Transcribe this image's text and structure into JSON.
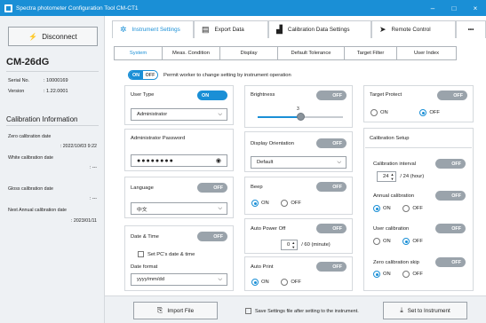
{
  "window": {
    "title": "Spectra photometer Configuration Tool CM-CT1",
    "minimize": "–",
    "maximize": "□",
    "close": "×"
  },
  "sidebar": {
    "disconnect_label": "Disconnect",
    "model": "CM-26dG",
    "serial_label": "Serial No.",
    "serial_value": ": 10000169",
    "version_label": "Version",
    "version_value": ": 1.22.0001",
    "cal_heading": "Calibration Information",
    "zero_label": "Zero calibration date",
    "zero_value": ": 2022/10/03 9:22",
    "white_label": "White calibration date",
    "white_value": ": ---",
    "gloss_label": "Gloss calibration date",
    "gloss_value": ": ---",
    "next_label": "Next Annual calibration date",
    "next_value": ": 2023/01/11"
  },
  "toptabs": [
    "Instrument Settings",
    "Export Data",
    "Calibration Data Settings",
    "Remote Control"
  ],
  "more": "•••",
  "subtabs": [
    "System",
    "Meas. Condition",
    "Display",
    "Default Tolerance",
    "Target Filter",
    "User Index"
  ],
  "permit": {
    "on": "ON",
    "off": "OFF",
    "text": "Permit worker to change setting by instrument operation"
  },
  "user_type": {
    "label": "User Type",
    "toggle": "ON",
    "value": "Administrator"
  },
  "admin_pw": {
    "label": "Administrator Password",
    "value": "●●●●●●●●"
  },
  "language": {
    "label": "Language",
    "toggle": "OFF",
    "value": "中文"
  },
  "datetime": {
    "label": "Date & Time",
    "toggle": "OFF",
    "set_pc": "Set PC's date & time",
    "format_label": "Date format",
    "format_value": "yyyy/mm/dd"
  },
  "brightness": {
    "label": "Brightness",
    "toggle": "OFF",
    "value": "3",
    "level": 0.5
  },
  "orientation": {
    "label": "Display Orientation",
    "toggle": "OFF",
    "value": "Default"
  },
  "beep": {
    "label": "Beep",
    "toggle": "OFF",
    "on": "ON",
    "off": "OFF"
  },
  "autopower": {
    "label": "Auto Power Off",
    "toggle": "OFF",
    "value": "0",
    "unit": "/ 60 (minute)"
  },
  "autoprint": {
    "label": "Auto Print",
    "toggle": "OFF",
    "on": "ON",
    "off": "OFF"
  },
  "target_protect": {
    "label": "Target Protect",
    "toggle": "OFF",
    "on": "ON",
    "off": "OFF"
  },
  "cal_setup": {
    "label": "Calibration Setup",
    "interval_label": "Calibration interval",
    "interval_toggle": "OFF",
    "interval_value": "24",
    "interval_unit": "/ 24 (hour)",
    "annual_label": "Annual calibration",
    "annual_toggle": "OFF",
    "user_label": "User calibration",
    "user_toggle": "OFF",
    "zero_skip_label": "Zero calibration skip",
    "zero_skip_toggle": "OFF",
    "on": "ON",
    "off": "OFF"
  },
  "bottom": {
    "import": "Import File",
    "save_text": "Save Settings file after setting to the instrument.",
    "set": "Set to Instrument"
  },
  "colors": {
    "accent": "#1a8fd6",
    "toggle_off": "#9aa3ab"
  }
}
